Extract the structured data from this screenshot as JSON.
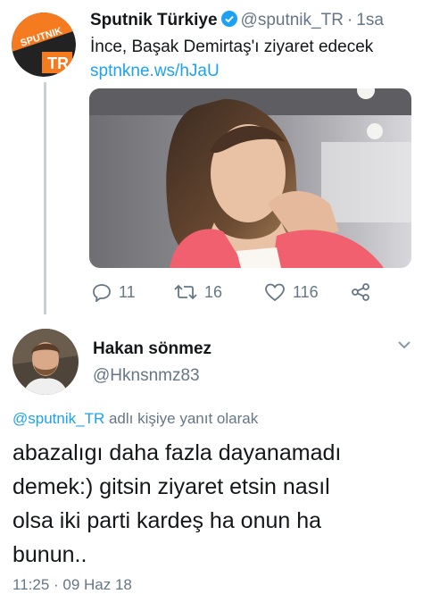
{
  "original_tweet": {
    "avatar_text": {
      "top": "SPUTNIK",
      "bottom": "TR"
    },
    "display_name": "Sputnik Türkiye",
    "handle": "@sputnik_TR",
    "separator": "·",
    "relative_time": "1sa",
    "text": "İnce, Başak Demirtaş'ı ziyaret edecek",
    "link": "sptnkne.ws/hJaU",
    "actions": {
      "reply_count": "11",
      "retweet_count": "16",
      "like_count": "116"
    }
  },
  "reply_tweet": {
    "display_name": "Hakan sönmez",
    "handle": "@Hknsnmz83",
    "reply_context_mention": "@sputnik_TR",
    "reply_context_text": " adlı kişiye yanıt olarak",
    "body_lines": [
      "abazalıgı daha fazla dayanamadı",
      "demek:) gitsin ziyaret etsin nasıl",
      "olsa iki parti kardeş ha onun ha",
      "bunun.."
    ],
    "timestamp": "11:25 · 09 Haz 18"
  },
  "colors": {
    "link_blue": "#1da1f2",
    "secondary_gray": "#657786",
    "brand_orange": "#f47b20",
    "jacket_pink": "#f0606e"
  },
  "icons": [
    "verified-badge-icon",
    "reply-icon",
    "retweet-icon",
    "like-icon",
    "share-icon",
    "chevron-down-icon"
  ]
}
